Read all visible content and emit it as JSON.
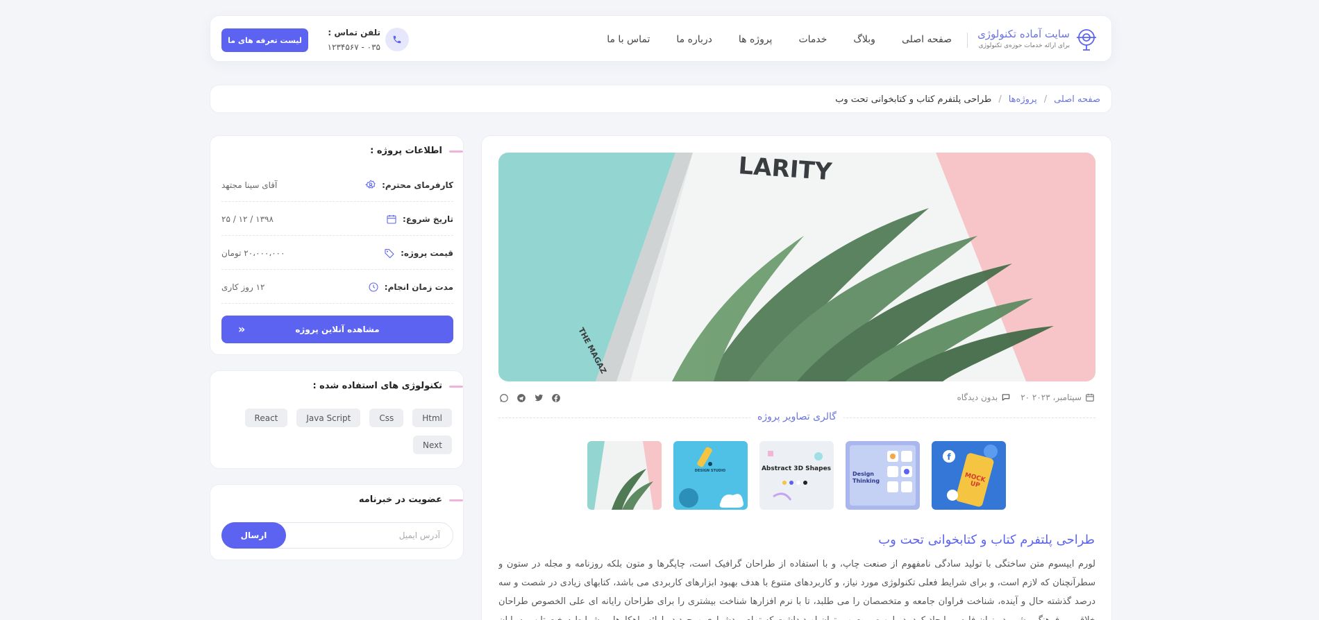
{
  "header": {
    "brand_title": "سایت آماده تکنولوژی",
    "brand_subtitle": "برای ارائه خدمات حوزه‌ی تکنولوژی",
    "nav": [
      {
        "label": "صفحه اصلی"
      },
      {
        "label": "وبلاگ"
      },
      {
        "label": "خدمات"
      },
      {
        "label": "پروژه ها"
      },
      {
        "label": "درباره ما"
      },
      {
        "label": "تماس با ما"
      }
    ],
    "phone_label": "تلفن تماس :",
    "phone_number": "۰۳۵ - ۱۲۳۴۵۶۷",
    "pricing_button": "لیست تعرفه های ما"
  },
  "breadcrumb": {
    "home": "صفحه اصلی",
    "sep1": "/",
    "projects": "پروژه‌ها",
    "sep2": "/",
    "current": "طراحی پلتفرم کتاب و کتابخوانی تحت وب"
  },
  "post": {
    "date": "۲۰ سپتامبر، ۲۰۲۳",
    "comments": "بدون دیدگاه",
    "gallery_title": "گالری تصاویر پروژه",
    "thumbs": [
      {
        "name": "mockup-thumb"
      },
      {
        "name": "design-thinking-thumb"
      },
      {
        "name": "abstract-shapes-thumb"
      },
      {
        "name": "design-studio-thumb"
      },
      {
        "name": "magazine-thumb"
      }
    ],
    "title": "طراحی پلتفرم کتاب و کتابخوانی تحت وب",
    "description": "لورم ایپسوم متن ساختگی با تولید سادگی نامفهوم از صنعت چاپ، و با استفاده از طراحان گرافیک است، چاپگرها و متون بلکه روزنامه و مجله در ستون و سطرآنچنان که لازم است، و برای شرایط فعلی تکنولوژی مورد نیاز، و کاربردهای متنوع با هدف بهبود ابزارهای کاربردی می باشد، کتابهای زیادی در شصت و سه درصد گذشته حال و آینده، شناخت فراوان جامعه و متخصصان را می طلبد، تا با نرم افزارها شناخت بیشتری را برای طراحان رایانه ای علی الخصوص طراحان خلاقی، و فرهنگ پیشرو در زبان فارسی ایجاد کرد، در این صورت می توان امید داشت که تمام و دشواری موجود در ارائه راهکارها، و شرایط سخت تایپ به پایان رسد و زمان مورد نیاز شامل حروفچینی دستاوردهای اصلی، و جوابگوی سوالات پیوسته اهل دنیای موجود طراحی اساسا مورد استفاده قرار گیرد."
  },
  "info": {
    "title": "اطلاعات پروژه :",
    "rows": [
      {
        "label": "کارفرمای محترم:",
        "value": "آقای سینا مجتهد"
      },
      {
        "label": "تاریخ شروع:",
        "value": "۱۳۹۸ / ۱۲ / ۲۵"
      },
      {
        "label": "قیمت پروژه:",
        "value": "۲۰،۰۰۰،۰۰۰ تومان"
      },
      {
        "label": "مدت زمان انجام:",
        "value": "۱۲ روز کاری"
      }
    ],
    "view_button": "مشاهده آنلاین پروژه",
    "view_arrow": "»"
  },
  "tech": {
    "title": "تکنولوژی های استفاده شده :",
    "tags": [
      "Html",
      "Css",
      "Java Script",
      "React",
      "Next"
    ]
  },
  "newsletter": {
    "title": "عضویت در خبرنامه",
    "placeholder": "آدرس ایمیل",
    "button": "ارسال"
  },
  "colors": {
    "accent": "#5b63f0",
    "page_bg": "#f4f5f9"
  }
}
